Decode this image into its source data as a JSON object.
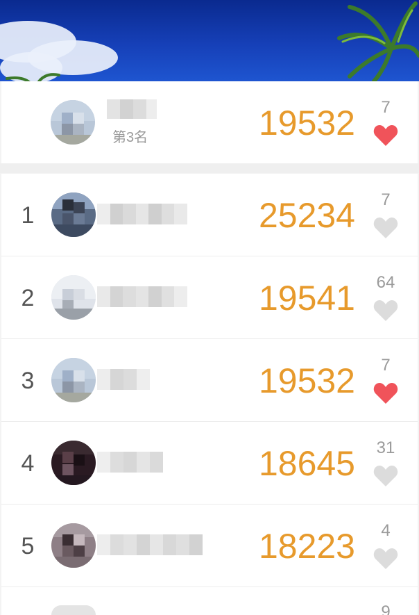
{
  "colors": {
    "score": "#e79a2c",
    "heart_active": "#f0535a",
    "heart_inactive": "#d9d9d9",
    "rank_text": "#555555",
    "likes_text": "#9a9a9a"
  },
  "my_entry": {
    "place_label": "第3名",
    "score": "19532",
    "likes": "7",
    "liked": true
  },
  "ranking": [
    {
      "rank": "1",
      "score": "25234",
      "likes": "7",
      "liked": false
    },
    {
      "rank": "2",
      "score": "19541",
      "likes": "64",
      "liked": false
    },
    {
      "rank": "3",
      "score": "19532",
      "likes": "7",
      "liked": true
    },
    {
      "rank": "4",
      "score": "18645",
      "likes": "31",
      "liked": false
    },
    {
      "rank": "5",
      "score": "18223",
      "likes": "4",
      "liked": false
    },
    {
      "rank": "",
      "score": "",
      "likes": "9",
      "liked": false
    }
  ],
  "icons": {
    "heart": "heart-icon",
    "avatar": "avatar"
  }
}
